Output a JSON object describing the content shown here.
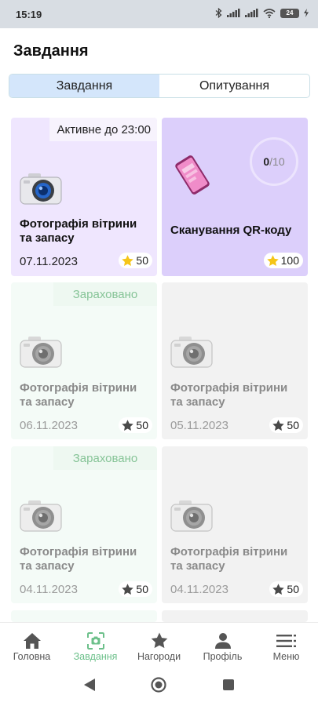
{
  "status_bar": {
    "time": "15:19",
    "battery": "24"
  },
  "page": {
    "title": "Завдання"
  },
  "tabs": [
    {
      "label": "Завдання",
      "active": true
    },
    {
      "label": "Опитування",
      "active": false
    }
  ],
  "cards": [
    {
      "badge": "Активне до  23:00",
      "icon": "camera-icon",
      "title": "Фотографія вітрини та запасу",
      "date": "07.11.2023",
      "points": "50",
      "state": "active"
    },
    {
      "progress_current": "0",
      "progress_total": "/10",
      "icon": "phone-qr-icon",
      "title": "Сканування QR-коду",
      "date": "",
      "points": "100",
      "state": "active"
    },
    {
      "badge": "Зараховано",
      "icon": "camera-icon",
      "title": "Фотографія вітрини та запасу",
      "date": "06.11.2023",
      "points": "50",
      "state": "credited"
    },
    {
      "icon": "camera-icon",
      "title": "Фотографія вітрини та запасу",
      "date": "05.11.2023",
      "points": "50",
      "state": "expired"
    },
    {
      "badge": "Зараховано",
      "icon": "camera-icon",
      "title": "Фотографія вітрини та запасу",
      "date": "04.11.2023",
      "points": "50",
      "state": "credited"
    },
    {
      "icon": "camera-icon",
      "title": "Фотографія вітрини та запасу",
      "date": "04.11.2023",
      "points": "50",
      "state": "expired"
    }
  ],
  "bottom_nav": [
    {
      "label": "Головна",
      "icon": "home-icon",
      "active": false
    },
    {
      "label": "Завдання",
      "icon": "scan-task-icon",
      "active": true
    },
    {
      "label": "Нагороди",
      "icon": "star-icon",
      "active": false
    },
    {
      "label": "Профіль",
      "icon": "person-icon",
      "active": false
    },
    {
      "label": "Меню",
      "icon": "menu-icon",
      "active": false
    }
  ],
  "colors": {
    "accent_green": "#6cc08a",
    "tab_active": "#d4e6fb",
    "card_purple_light": "#efe6fe",
    "card_purple": "#dccffb",
    "credited_text": "#86c497",
    "star_gold": "#f5c518"
  }
}
